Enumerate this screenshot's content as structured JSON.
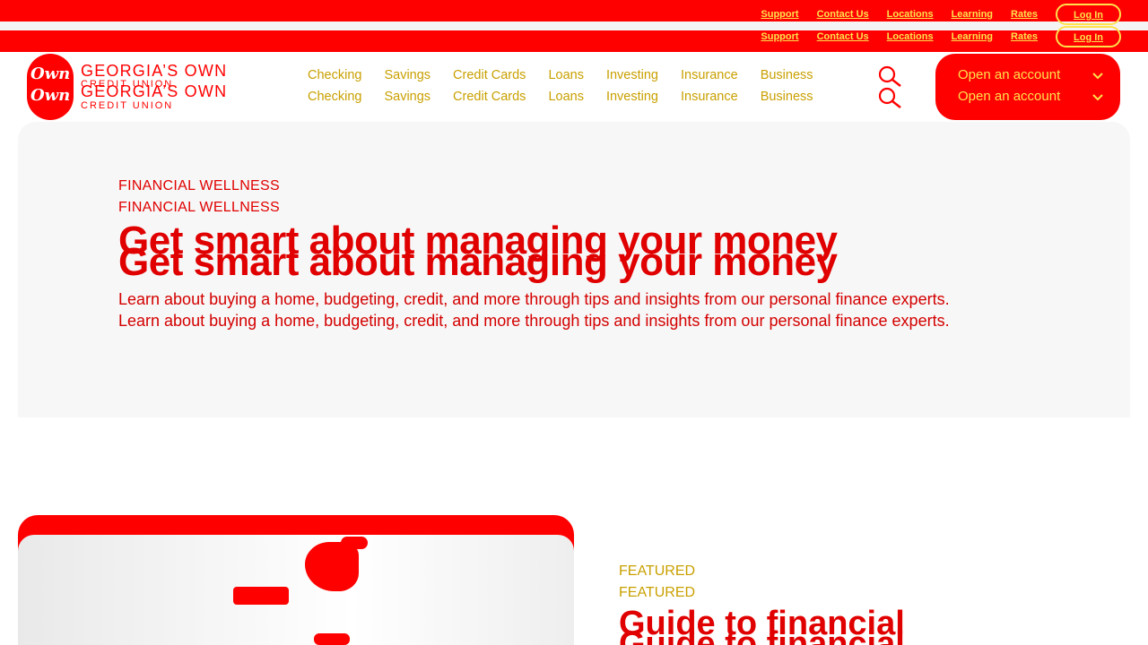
{
  "utility_nav": {
    "links": [
      "Support",
      "Contact Us",
      "Locations",
      "Learning",
      "Rates"
    ],
    "login_label": "Log In"
  },
  "brand": {
    "script": "Own",
    "name": "GEORGIA’S OWN",
    "subtitle": "CREDIT UNION"
  },
  "main_nav": {
    "items": [
      "Checking",
      "Savings",
      "Credit Cards",
      "Loans",
      "Investing",
      "Insurance",
      "Business"
    ],
    "open_account_label": "Open an account"
  },
  "hero": {
    "eyebrow": "FINANCIAL WELLNESS",
    "headline": "Get smart about managing your money",
    "lede": "Learn about buying a home, budgeting, credit, and more through tips and insights from our personal finance experts."
  },
  "featured": {
    "eyebrow": "FEATURED",
    "title": "Guide to financial"
  },
  "colors": {
    "brand_red": "#ff0000",
    "accent_yellow": "#ffe14d",
    "nav_text": "#c9a000",
    "hero_bg": "#f7f7f7"
  },
  "icons": [
    "search-icon",
    "chevron-down-icon"
  ]
}
